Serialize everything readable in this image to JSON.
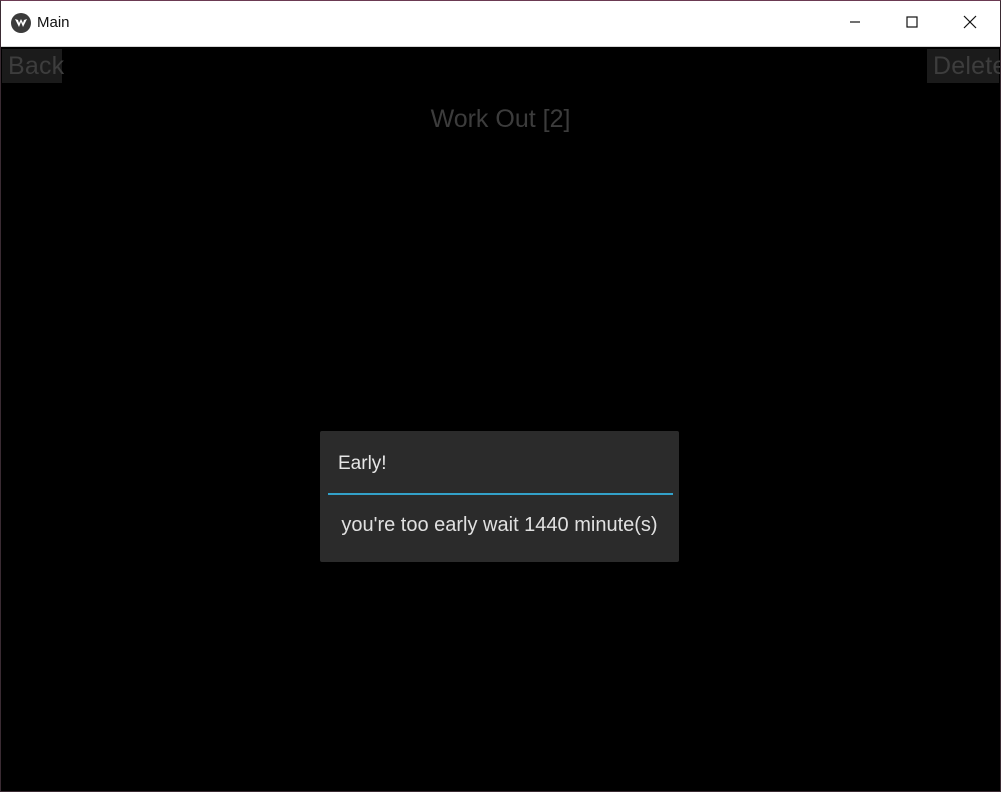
{
  "window": {
    "title": "Main",
    "controls": {
      "minimize_icon": "minimize-icon",
      "maximize_icon": "maximize-icon",
      "close_icon": "close-icon"
    }
  },
  "toolbar": {
    "back_label": "Back",
    "delete_label": "Delete"
  },
  "screen": {
    "title": "Work Out [2]"
  },
  "popup": {
    "title": "Early!",
    "message": "you're too early wait 1440 minute(s)",
    "separator_color": "#33a1c9"
  },
  "colors": {
    "background": "#000000",
    "popup_background": "#2b2b2b",
    "muted_text": "#3c3c3c",
    "accent": "#33a1c9"
  }
}
